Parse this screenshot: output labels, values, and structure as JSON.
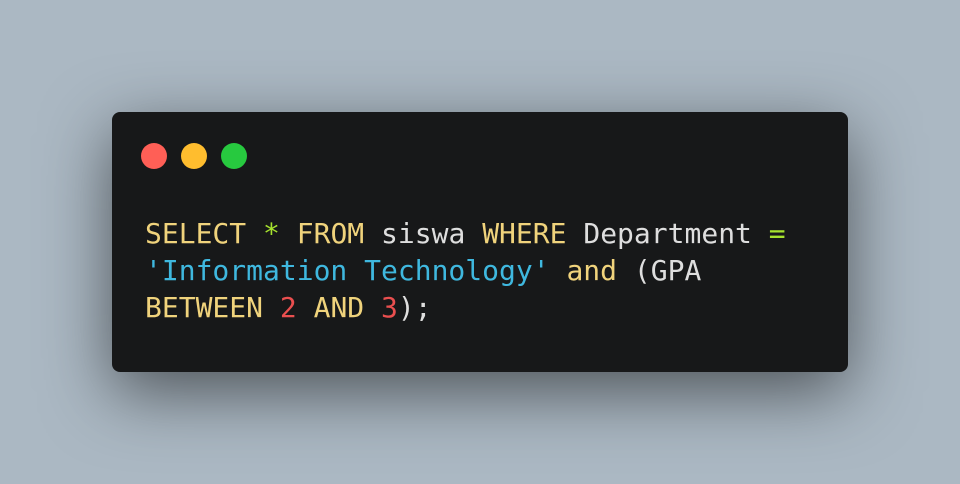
{
  "colors": {
    "background": "#abb8c3",
    "window": "#171819",
    "keyword": "#f0d37c",
    "operator": "#a6e22e",
    "identifier": "#dedede",
    "string": "#3fb8df",
    "number": "#ea4f4f"
  },
  "window_controls": [
    {
      "name": "close-dot",
      "color": "#ff5f56"
    },
    {
      "name": "minimize-dot",
      "color": "#ffbd2e"
    },
    {
      "name": "maximize-dot",
      "color": "#27c93f"
    }
  ],
  "code": {
    "lines": [
      [
        {
          "type": "keyword",
          "text": "SELECT"
        },
        {
          "type": "ident",
          "text": " "
        },
        {
          "type": "operator",
          "text": "*"
        },
        {
          "type": "ident",
          "text": " "
        },
        {
          "type": "keyword",
          "text": "FROM"
        },
        {
          "type": "ident",
          "text": " siswa "
        },
        {
          "type": "keyword",
          "text": "WHERE"
        },
        {
          "type": "ident",
          "text": " Department "
        },
        {
          "type": "operator",
          "text": "="
        }
      ],
      [
        {
          "type": "string",
          "text": "'Information Technology'"
        },
        {
          "type": "ident",
          "text": " "
        },
        {
          "type": "keyword",
          "text": "and"
        },
        {
          "type": "ident",
          "text": " (GPA"
        }
      ],
      [
        {
          "type": "keyword",
          "text": "BETWEEN"
        },
        {
          "type": "ident",
          "text": " "
        },
        {
          "type": "number",
          "text": "2"
        },
        {
          "type": "ident",
          "text": " "
        },
        {
          "type": "keyword",
          "text": "AND"
        },
        {
          "type": "ident",
          "text": " "
        },
        {
          "type": "number",
          "text": "3"
        },
        {
          "type": "punct",
          "text": ");"
        }
      ]
    ]
  }
}
